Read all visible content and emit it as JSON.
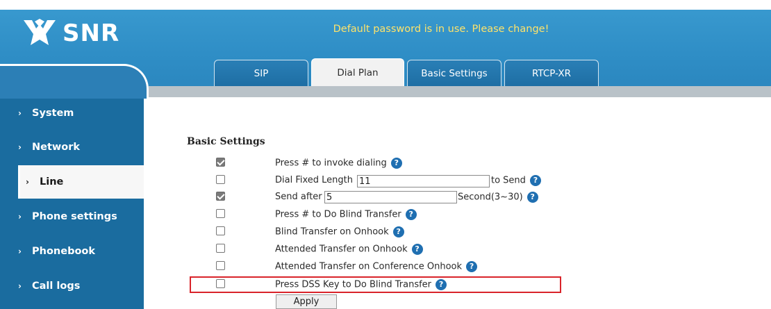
{
  "brand": {
    "name": "SNR"
  },
  "header": {
    "notice": "Default password is in use. Please change!"
  },
  "tabs": [
    {
      "label": "SIP",
      "active": false
    },
    {
      "label": "Dial Plan",
      "active": true
    },
    {
      "label": "Basic Settings",
      "active": false
    },
    {
      "label": "RTCP-XR",
      "active": false
    }
  ],
  "sidebar": {
    "items": [
      {
        "label": "System",
        "active": false
      },
      {
        "label": "Network",
        "active": false
      },
      {
        "label": "Line",
        "active": true
      },
      {
        "label": "Phone settings",
        "active": false
      },
      {
        "label": "Phonebook",
        "active": false
      },
      {
        "label": "Call logs",
        "active": false
      }
    ]
  },
  "section": {
    "title": "Basic Settings"
  },
  "settings": [
    {
      "label": "Press # to invoke dialing",
      "checked": true
    },
    {
      "label": "Dial Fixed Length",
      "checked": false,
      "input_value": "11",
      "suffix": "to Send"
    },
    {
      "label": "Send after",
      "checked": true,
      "input_value": "5",
      "suffix": "Second(3~30)"
    },
    {
      "label": "Press # to Do Blind Transfer",
      "checked": false
    },
    {
      "label": "Blind Transfer on Onhook",
      "checked": false
    },
    {
      "label": "Attended Transfer on Onhook",
      "checked": false
    },
    {
      "label": "Attended Transfer on Conference Onhook",
      "checked": false
    },
    {
      "label": "Press DSS Key to Do Blind Transfer",
      "checked": false,
      "highlighted": true
    }
  ],
  "apply_label": "Apply",
  "colors": {
    "header": "#2f8ec6",
    "sidebar": "#1a6c9f",
    "notice": "#ffe36a",
    "highlight": "#d9232a",
    "help": "#1f6fb1"
  }
}
